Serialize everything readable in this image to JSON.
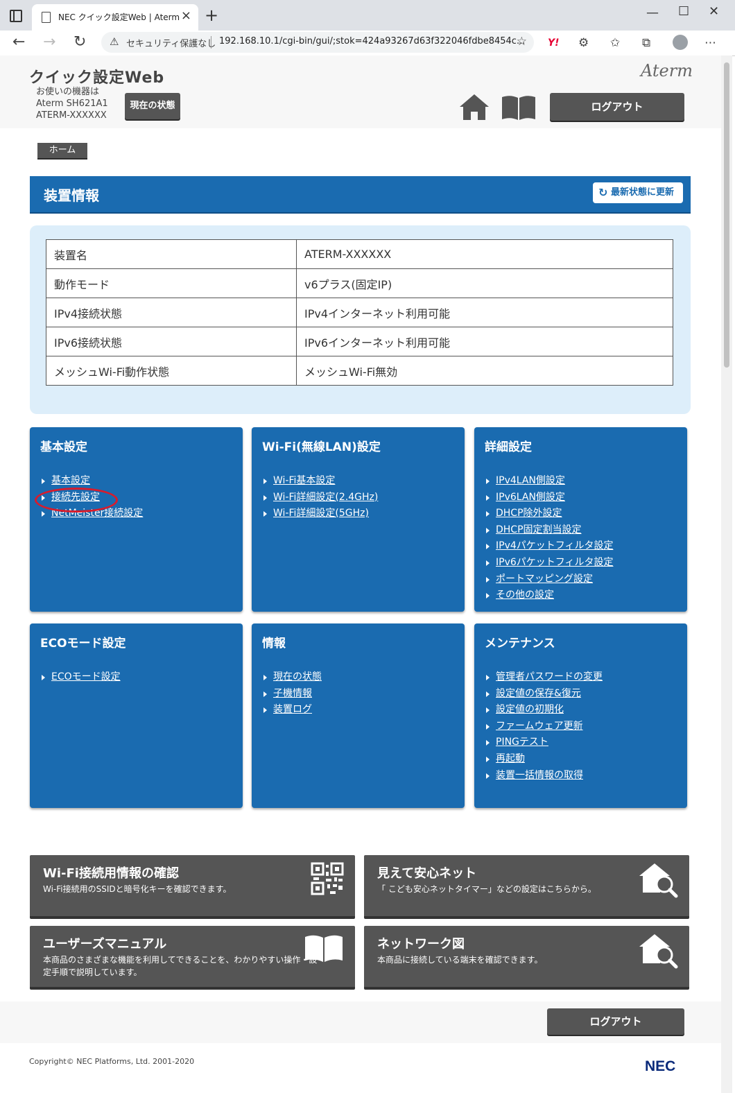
{
  "browser": {
    "tab_title": "NEC クイック設定Web | Aterm",
    "security": "セキュリティ保護なし",
    "url": "192.168.10.1/cgi-bin/gui/;stok=424a93267d63f322046fdbe8454c..."
  },
  "header": {
    "brand": "クイック設定Web",
    "model_line1": "お使いの機器は",
    "model_line2": "Aterm SH621A1",
    "model_line3": "ATERM-XXXXXX",
    "status_button": "現在の状態",
    "logo": "Aterm",
    "logout": "ログアウト"
  },
  "breadcrumb": {
    "home": "ホーム"
  },
  "banner": {
    "title": "装置情報",
    "refresh": "最新状態に更新"
  },
  "info_table": [
    {
      "key": "装置名",
      "value": "ATERM-XXXXXX"
    },
    {
      "key": "動作モード",
      "value": "v6プラス(固定IP)"
    },
    {
      "key": "IPv4接続状態",
      "value": "IPv4インターネット利用可能"
    },
    {
      "key": "IPv6接続状態",
      "value": "IPv6インターネット利用可能"
    },
    {
      "key": "メッシュWi-Fi動作状態",
      "value": "メッシュWi-Fi無効"
    }
  ],
  "cards": [
    {
      "title": "基本設定",
      "items": [
        "基本設定",
        "接続先設定",
        "NetMeister接続設定"
      ]
    },
    {
      "title": "Wi-Fi(無線LAN)設定",
      "items": [
        "Wi-Fi基本設定",
        "Wi-Fi詳細設定(2.4GHz)",
        "Wi-Fi詳細設定(5GHz)"
      ]
    },
    {
      "title": "詳細設定",
      "items": [
        "IPv4LAN側設定",
        "IPv6LAN側設定",
        "DHCP除外設定",
        "DHCP固定割当設定",
        "IPv4パケットフィルタ設定",
        "IPv6パケットフィルタ設定",
        "ポートマッピング設定",
        "その他の設定"
      ]
    },
    {
      "title": "ECOモード設定",
      "items": [
        "ECOモード設定"
      ]
    },
    {
      "title": "情報",
      "items": [
        "現在の状態",
        "子機情報",
        "装置ログ"
      ]
    },
    {
      "title": "メンテナンス",
      "items": [
        "管理者パスワードの変更",
        "設定値の保存&復元",
        "設定値の初期化",
        "ファームウェア更新",
        "PINGテスト",
        "再起動",
        "装置一括情報の取得"
      ]
    }
  ],
  "bottom_cards": [
    {
      "title": "Wi-Fi接続用情報の確認",
      "desc": "Wi-Fi接続用のSSIDと暗号化キーを確認できます。",
      "icon": "qr-code-icon"
    },
    {
      "title": "見えて安心ネット",
      "desc": "「 こども安心ネットタイマー」などの設定はこちらから。",
      "icon": "house-search-icon"
    },
    {
      "title": "ユーザーズマニュアル",
      "desc": "本商品のさまざまな機能を利用してできることを、わかりやすい操作・設定手順で説明しています。",
      "icon": "open-book-icon"
    },
    {
      "title": "ネットワーク図",
      "desc": "本商品に接続している端末を確認できます。",
      "icon": "house-search-icon"
    }
  ],
  "footer": {
    "logout": "ログアウト",
    "copyright": "Copyright© NEC Platforms, Ltd. 2001-2020",
    "nec_logo": "NEC"
  },
  "colors": {
    "accent": "#1a6bb0",
    "dark_button": "#555555",
    "highlight_circle": "#d81c2c"
  }
}
